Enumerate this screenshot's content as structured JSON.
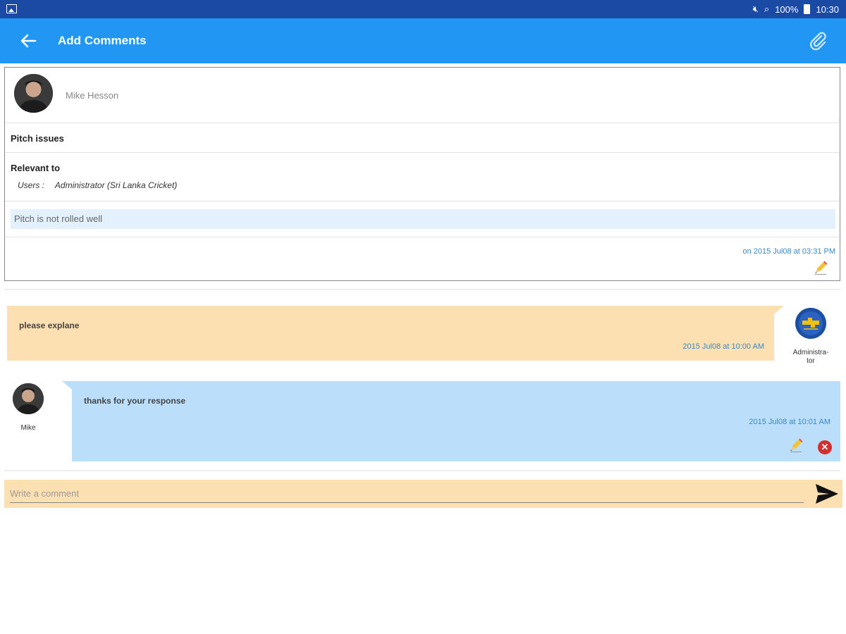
{
  "status_bar": {
    "battery": "100%",
    "time": "10:30"
  },
  "app_bar": {
    "title": "Add Comments"
  },
  "topic": {
    "author": "Mike Hesson",
    "subject": "Pitch issues",
    "relevant_heading": "Relevant to",
    "users_label": "Users :",
    "users_value": "Administrator (Sri Lanka Cricket)",
    "description": "Pitch is not rolled well",
    "posted": "on 2015 Jul08 at 03:31 PM"
  },
  "comments": [
    {
      "text": "please explane",
      "date": "2015 Jul08 at 10:00 AM",
      "user": "Administra-\ntor"
    },
    {
      "text": "thanks for your response",
      "date": "2015 Jul08 at 10:01 AM",
      "user": "Mike"
    }
  ],
  "composer": {
    "placeholder": "Write a comment",
    "value": ""
  },
  "colors": {
    "status_bar": "#1a4aa3",
    "app_bar": "#2196f3",
    "admin_bubble": "#fde0b2",
    "user_bubble": "#bbdefb",
    "date_text": "#3b88c3"
  }
}
